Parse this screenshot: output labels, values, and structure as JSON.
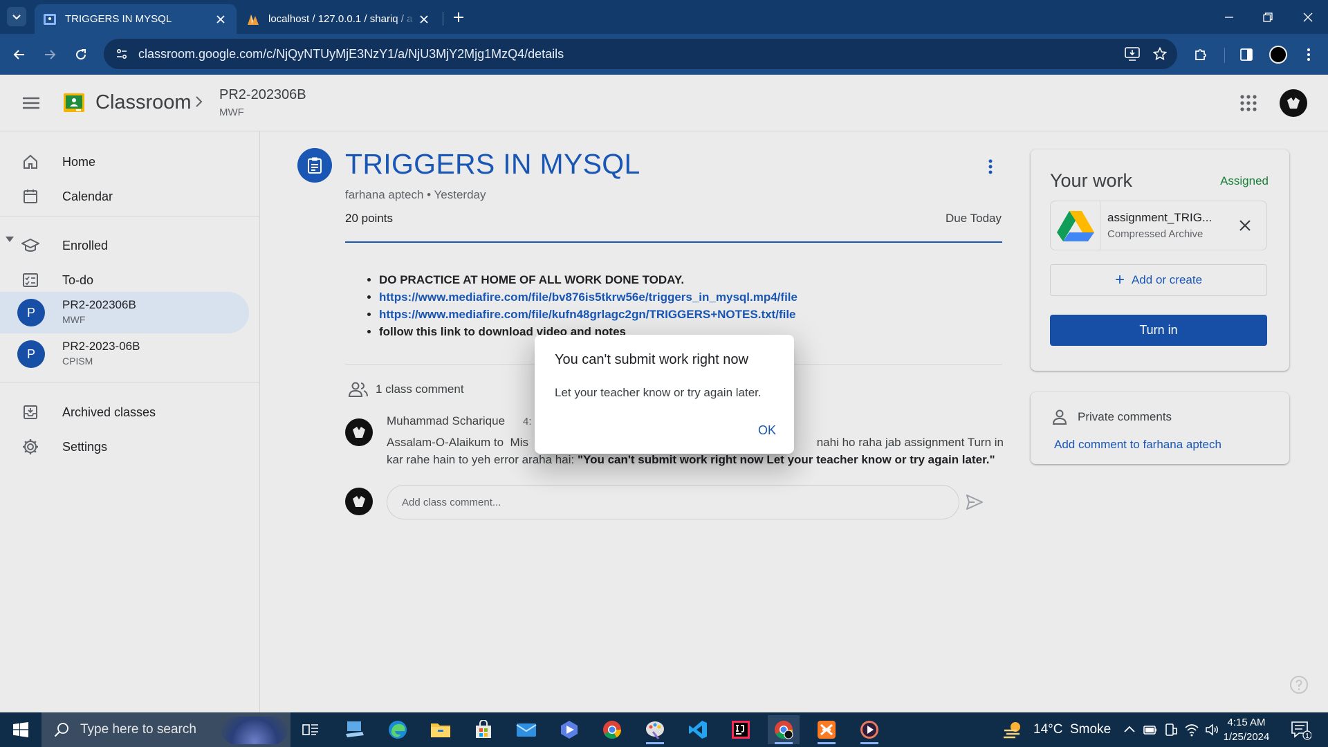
{
  "browser": {
    "tabs": [
      {
        "title": "TRIGGERS IN MYSQL",
        "active": true
      },
      {
        "title": "localhost / 127.0.0.1 / shariq / a",
        "active": false
      }
    ],
    "url": "classroom.google.com/c/NjQyNTUyMjE3NzY1/a/NjU3MjY2Mjg1MzQ4/details"
  },
  "header": {
    "app_name": "Classroom",
    "class_name": "PR2-202306B",
    "class_section": "MWF"
  },
  "sidebar": {
    "home": "Home",
    "calendar": "Calendar",
    "enrolled": "Enrolled",
    "todo": "To-do",
    "classes": [
      {
        "initial": "P",
        "name": "PR2-202306B",
        "section": "MWF",
        "active": true
      },
      {
        "initial": "P",
        "name": "PR2-2023-06B",
        "section": "CPISM",
        "active": false
      }
    ],
    "archived": "Archived classes",
    "settings": "Settings"
  },
  "assignment": {
    "title": "TRIGGERS IN MYSQL",
    "meta": "farhana aptech • Yesterday",
    "points": "20 points",
    "due": "Due Today",
    "instructions": [
      {
        "text": "DO PRACTICE AT HOME OF ALL WORK DONE TODAY.",
        "link": false
      },
      {
        "text": "https://www.mediafire.com/file/bv876is5tkrw56e/triggers_in_mysql.mp4/file",
        "link": true
      },
      {
        "text": "https://www.mediafire.com/file/kufn48grlagc2gn/TRIGGERS+NOTES.txt/file",
        "link": true
      },
      {
        "text": "follow this link to download video and notes",
        "link": false
      }
    ]
  },
  "comments": {
    "header": "1 class comment",
    "items": [
      {
        "author": "Muhammad Scharique",
        "time": "4:",
        "text_start": "Assalam-O-Alaikum to  Mis",
        "text_end": "nahi ho raha jab assignment Turn in",
        "text_line2": "kar rahe hain to yeh error araha hai: ",
        "text_bold": "\"You can't submit work right now Let your teacher know or try again later.\""
      }
    ],
    "input_placeholder": "Add class comment..."
  },
  "your_work": {
    "title": "Your work",
    "status": "Assigned",
    "attachment": {
      "name": "assignment_TRIG...",
      "type": "Compressed Archive"
    },
    "add_create": "Add or create",
    "turn_in": "Turn in"
  },
  "private_comments": {
    "title": "Private comments",
    "link": "Add comment to farhana aptech"
  },
  "dialog": {
    "title": "You can't submit work right now",
    "message": "Let your teacher know or try again later.",
    "ok": "OK"
  },
  "taskbar": {
    "search_placeholder": "Type here to search",
    "weather": "14°C  Smoke",
    "time": "4:15 AM",
    "date": "1/25/2024",
    "notification_count": "1"
  },
  "colors": {
    "accent": "#1a57b5",
    "turn_in": "#174ea6",
    "assigned_status": "#188038",
    "chrome_tabstrip": "#123a6b",
    "chrome_toolbar": "#1d4d86"
  }
}
